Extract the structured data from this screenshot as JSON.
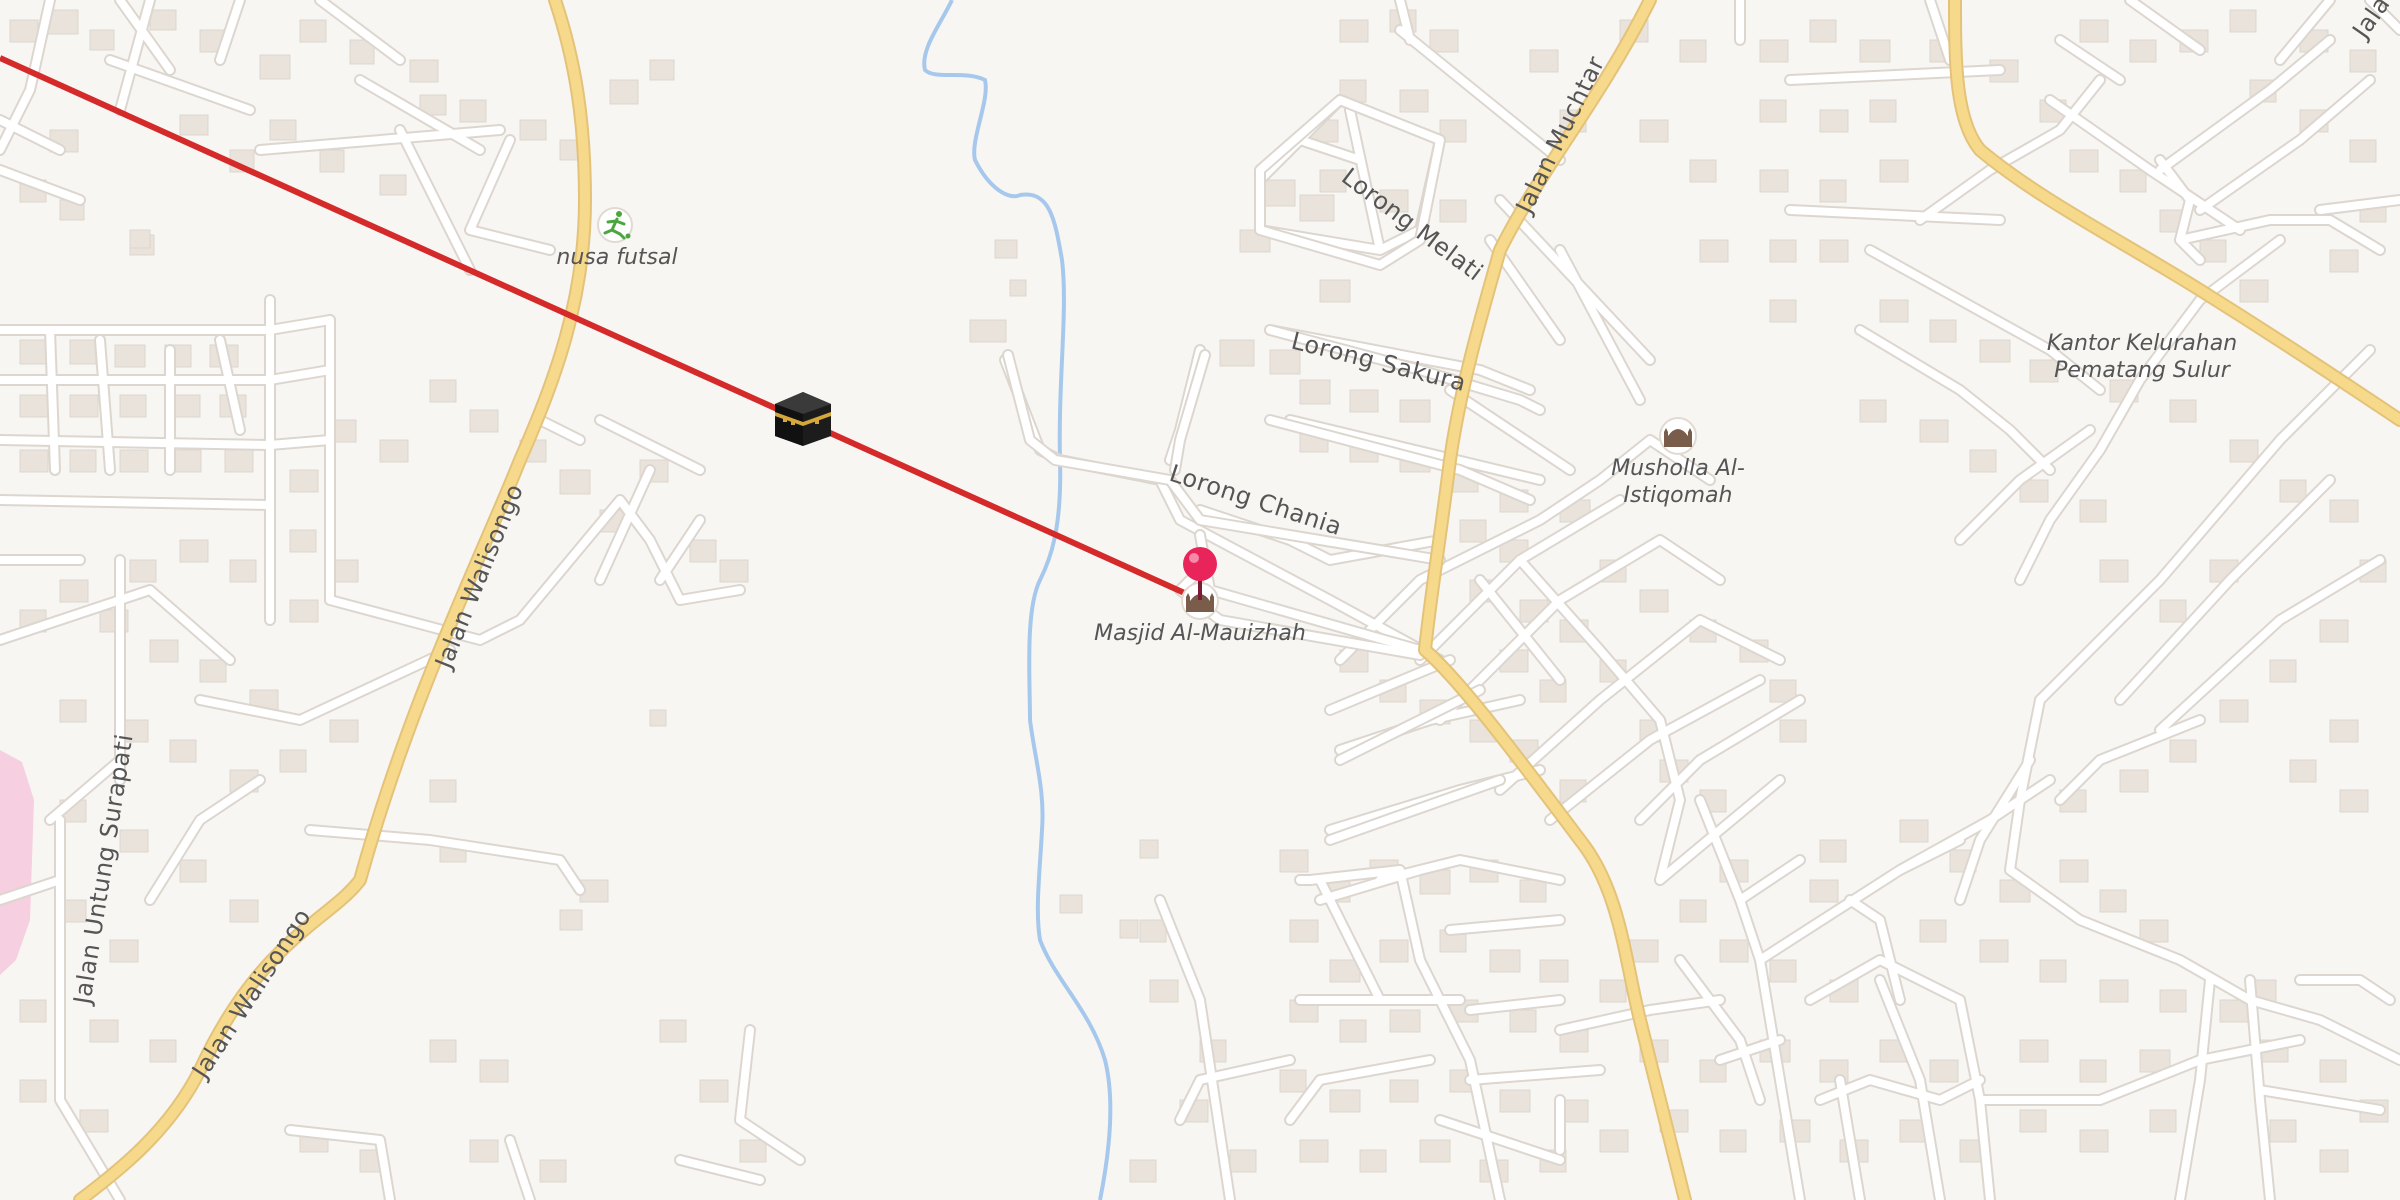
{
  "map": {
    "roads": {
      "jalan_walisongo_upper": "Jalan Walisongo",
      "jalan_walisongo_lower": "Jalan Walisongo",
      "jalan_untung_surapati": "Jalan Untung Surapati",
      "jalan_muchtar": "Jalan Muchtar",
      "jalan_edge": "Jala",
      "lorong_melati": "Lorong Melati",
      "lorong_sakura": "Lorong Sakura",
      "lorong_chania": "Lorong Chania"
    },
    "pois": {
      "nusa_futsal": "nusa futsal",
      "masjid": "Masjid Al-Mauizhah",
      "musholla_line1": "Musholla Al-",
      "musholla_line2": "Istiqomah",
      "kantor_line1": "Kantor Kelurahan",
      "kantor_line2": "Pematang Sulur"
    },
    "colors": {
      "background": "#f8f6f3",
      "building": "#e9e3dc",
      "minor_road": "#ffffff",
      "major_road": "#f7d98b",
      "major_road_casing": "#e3c37a",
      "water": "#a6c8ec",
      "qibla_line": "#d42a2a",
      "pin": "#e8245a",
      "pink_area": "#f6cfe0"
    },
    "icons": {
      "kaaba": "kaaba-icon",
      "pin": "location-pin-icon",
      "mosque": "mosque-icon",
      "soccer": "soccer-icon"
    }
  }
}
